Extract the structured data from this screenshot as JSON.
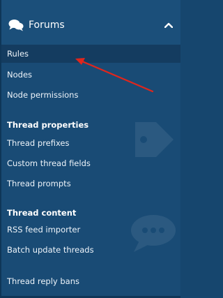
{
  "section": {
    "title": "Forums",
    "icon": "chat-bubbles-icon",
    "toggle_icon": "chevron-up-icon"
  },
  "nav": {
    "rules": "Rules",
    "nodes": "Nodes",
    "node_permissions": "Node permissions",
    "thread_properties_heading": "Thread properties",
    "thread_prefixes": "Thread prefixes",
    "custom_thread_fields": "Custom thread fields",
    "thread_prompts": "Thread prompts",
    "thread_content_heading": "Thread content",
    "rss_feed_importer": "RSS feed importer",
    "batch_update_threads": "Batch update threads",
    "thread_reply_bans": "Thread reply bans"
  },
  "selected_item": "Rules",
  "colors": {
    "panel_bg": "#194b75",
    "selected_bg": "#143c60",
    "annotation_arrow": "#e0261c"
  }
}
